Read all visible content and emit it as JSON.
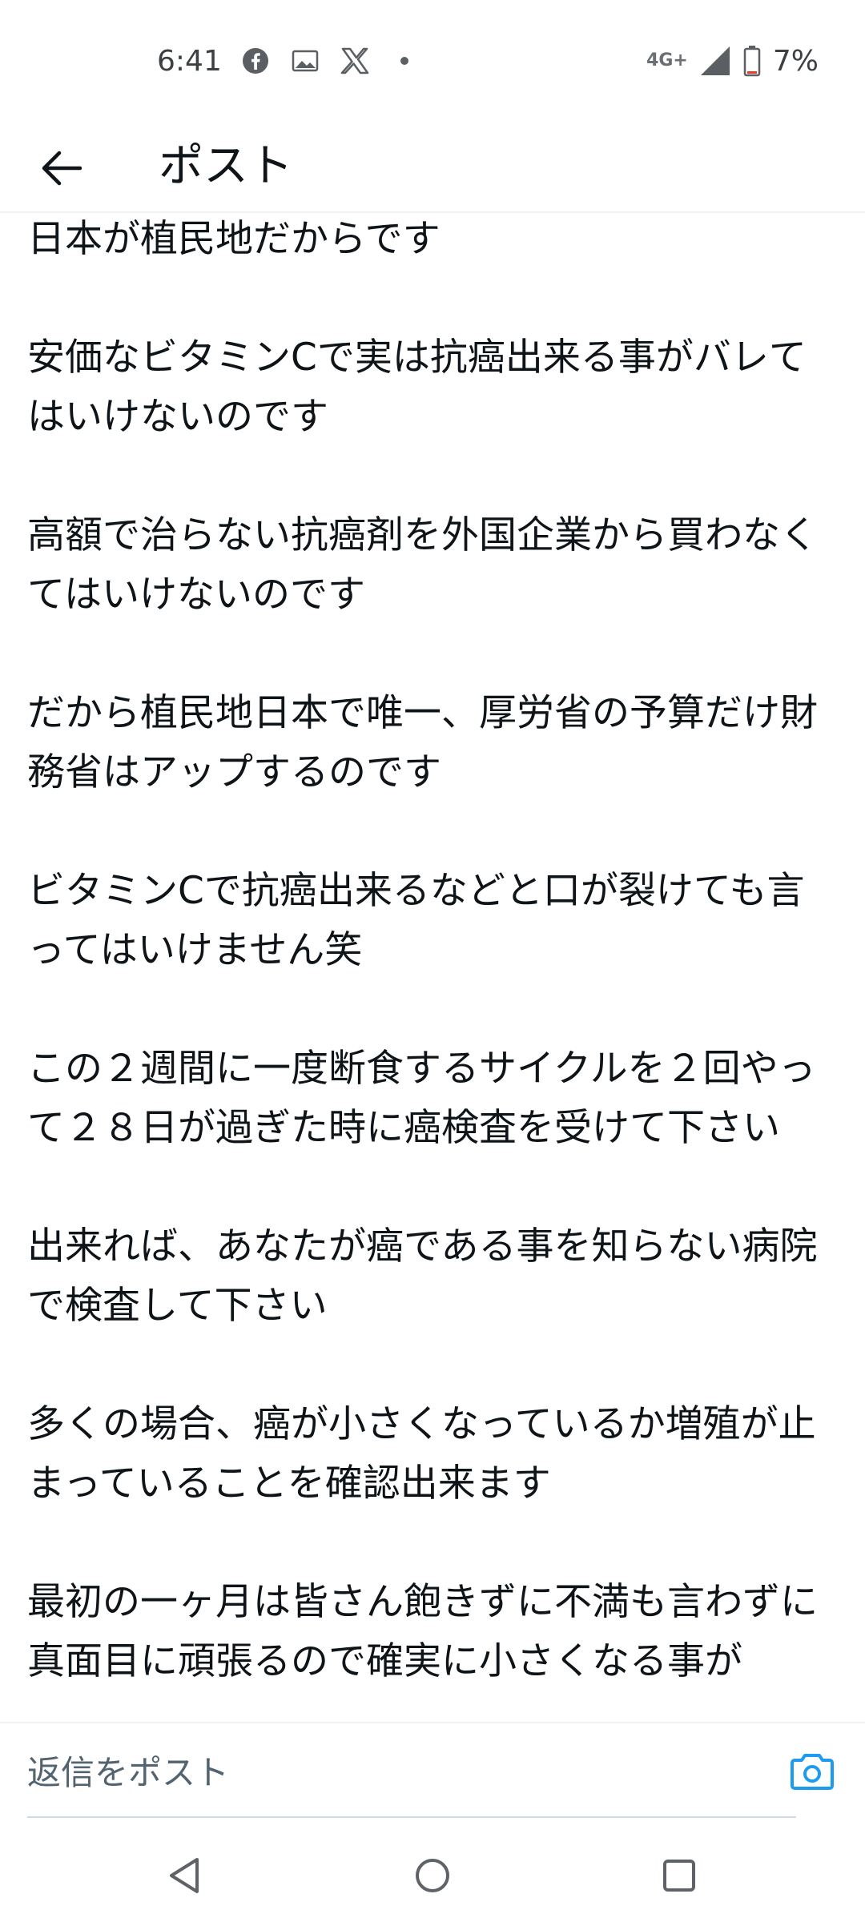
{
  "status_bar": {
    "time": "6:41",
    "notification_icons": [
      "facebook-icon",
      "image-icon",
      "x-icon",
      "dot-icon"
    ],
    "network_type": "4G+",
    "battery_percent": "7%"
  },
  "header": {
    "title": "ポスト"
  },
  "post": {
    "paragraphs": [
      "日本が植民地だからです",
      "安価なビタミンCで実は抗癌出来る事がバレてはいけないのです",
      "高額で治らない抗癌剤を外国企業から買わなくてはいけないのです",
      "だから植民地日本で唯一、厚労省の予算だけ財務省はアップするのです",
      "ビタミンCで抗癌出来るなどと口が裂けても言ってはいけません笑",
      "この２週間に一度断食するサイクルを２回やって２８日が過ぎた時に癌検査を受けて下さい",
      "出来れば、あなたが癌である事を知らない病院で検査して下さい",
      "多くの場合、癌が小さくなっているか増殖が止まっていることを確認出来ます",
      "最初の一ヶ月は皆さん飽きずに不満も言わずに真面目に頑張るので確実に小さくなる事が"
    ]
  },
  "reply": {
    "placeholder": "返信をポスト"
  },
  "colors": {
    "accent": "#1d9bf0",
    "text": "#0f1419",
    "muted": "#536471"
  }
}
